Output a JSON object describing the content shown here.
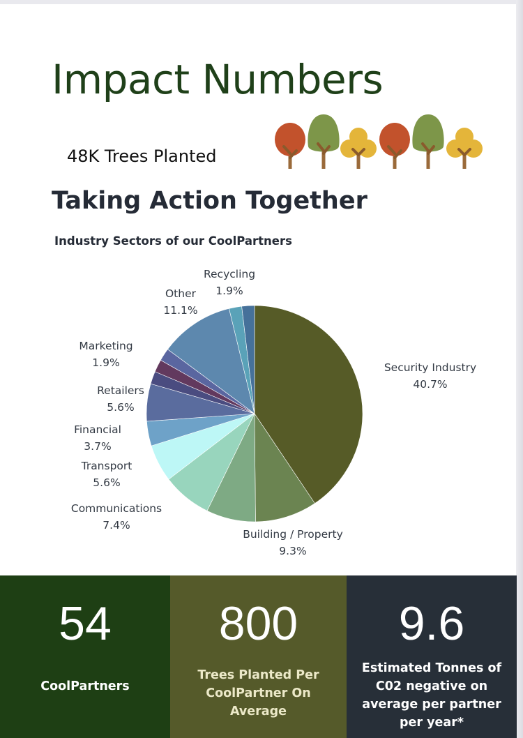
{
  "header": {
    "title": "Impact Numbers",
    "trees_planted": "48K Trees Planted",
    "subtitle": "Taking Action Together"
  },
  "tree_icons": [
    {
      "name": "orange-tree-icon",
      "color": "#c2522c"
    },
    {
      "name": "green-tree-icon",
      "color": "#7d9649"
    },
    {
      "name": "yellow-tree-icon",
      "color": "#e4b53a"
    },
    {
      "name": "orange-tree-icon",
      "color": "#c2522c"
    },
    {
      "name": "green-tree-icon",
      "color": "#7d9649"
    },
    {
      "name": "yellow-tree-icon",
      "color": "#e4b53a"
    }
  ],
  "chart_data": {
    "type": "pie",
    "title": "Industry Sectors of our CoolPartners",
    "slices": [
      {
        "label": "Security Industry",
        "value": 40.7,
        "display": "40.7%",
        "color": "#565b27"
      },
      {
        "label": "Building / Property",
        "value": 9.3,
        "display": "9.3%",
        "color": "#6b8451"
      },
      {
        "label": "",
        "value": 7.4,
        "display": "",
        "color": "#7eaa84"
      },
      {
        "label": "Communications",
        "value": 7.4,
        "display": "7.4%",
        "color": "#98d5bd"
      },
      {
        "label": "Transport",
        "value": 5.6,
        "display": "5.6%",
        "color": "#bdf7f6"
      },
      {
        "label": "Financial",
        "value": 3.7,
        "display": "3.7%",
        "color": "#6ea2c8"
      },
      {
        "label": "Retailers",
        "value": 5.6,
        "display": "5.6%",
        "color": "#5a6c9e"
      },
      {
        "label": "",
        "value": 1.9,
        "display": "",
        "color": "#4a4c80"
      },
      {
        "label": "",
        "value": 1.9,
        "display": "",
        "color": "#62395e"
      },
      {
        "label": "Marketing",
        "value": 1.9,
        "display": "1.9%",
        "color": "#5a66a0"
      },
      {
        "label": "Other",
        "value": 11.1,
        "display": "11.1%",
        "color": "#5d88ae"
      },
      {
        "label": "Recycling",
        "value": 1.9,
        "display": "1.9%",
        "color": "#5aa2b8"
      },
      {
        "label": "",
        "value": 1.9,
        "display": "",
        "color": "#46719a"
      }
    ]
  },
  "stats": [
    {
      "value": "54",
      "label": "CoolPartners"
    },
    {
      "value": "800",
      "label": "Trees Planted Per CoolPartner On Average"
    },
    {
      "value": "9.6",
      "label": "Estimated Tonnes of C02 negative on average per partner per year*"
    }
  ],
  "colors": {
    "title": "#1f4019",
    "dark_green": "#1e3f14",
    "olive": "#555a2a",
    "slate": "#272f38"
  }
}
